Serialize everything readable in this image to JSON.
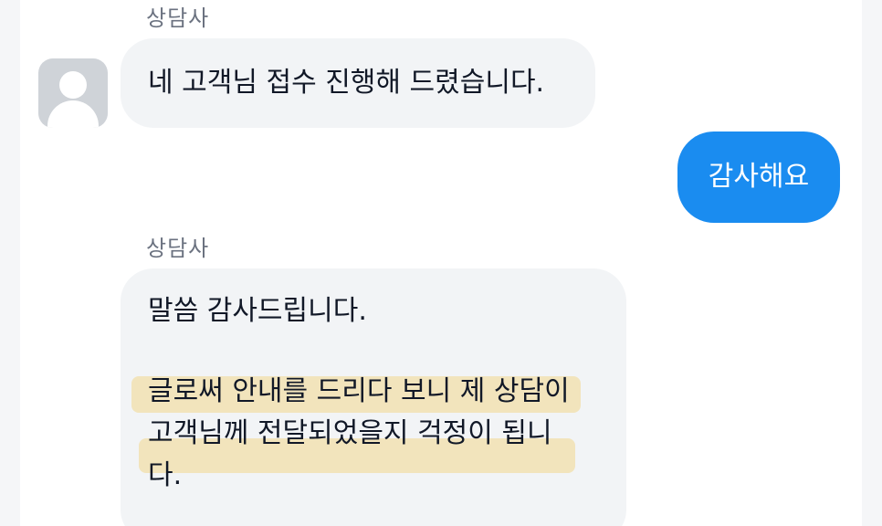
{
  "conversation": {
    "agent_name_1": "상담사",
    "message_1": "네 고객님 접수 진행해 드렸습니다.",
    "user_message": "감사해요",
    "agent_name_2": "상담사",
    "message_3": {
      "line_1": "말씀 감사드립니다.",
      "line_2": "글로써 안내를 드리다 보니 제 상담이",
      "line_3": "고객님께 전달되었을지 걱정이 됩니",
      "line_4": "다."
    }
  },
  "colors": {
    "user_bubble": "#1a8cf0",
    "agent_bubble": "#f2f4f6",
    "highlight": "#f2d78c"
  },
  "icons": {
    "avatar": "default-user-avatar-icon"
  }
}
